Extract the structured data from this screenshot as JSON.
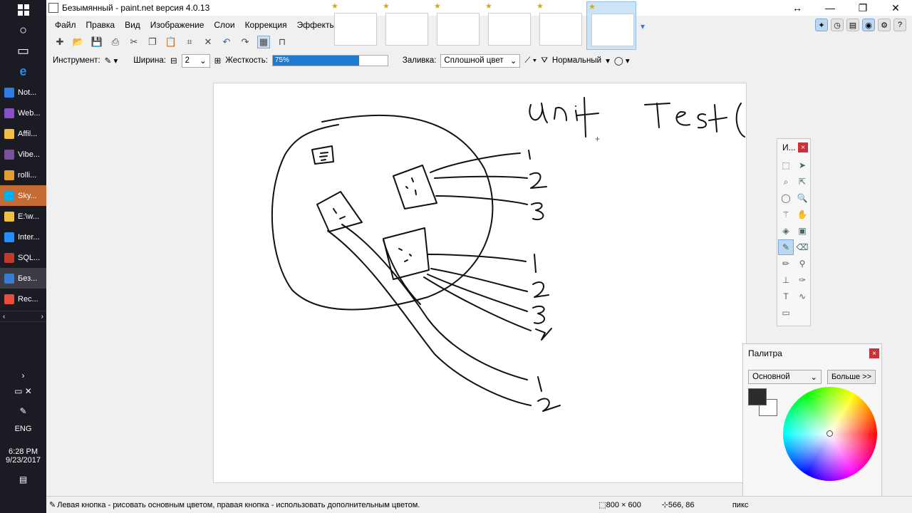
{
  "window": {
    "title": "Безымянный - paint.net версия 4.0.13"
  },
  "menu": {
    "items": [
      "Файл",
      "Правка",
      "Вид",
      "Изображение",
      "Слои",
      "Коррекция",
      "Эффекты"
    ]
  },
  "toolbar": {
    "tool_label": "Инструмент:",
    "width_label": "Ширина:",
    "width_value": "2",
    "hardness_label": "Жесткость:",
    "hardness_value": "75%",
    "hardness_fraction": 0.75,
    "fill_label": "Заливка:",
    "fill_value": "Сплошной цвет",
    "blend_value": "Нормальный"
  },
  "tools_panel": {
    "title": "И...",
    "close": "×"
  },
  "palette": {
    "title": "Палитра",
    "close": "×",
    "mode": "Основной",
    "more": "Больше >>",
    "primary_color": "#2c2c2c",
    "secondary_color": "#ffffff"
  },
  "status": {
    "hint": "Левая кнопка - рисовать основным цветом, правая кнопка - использовать дополнительным цветом.",
    "image_size": "800 × 600",
    "cursor_pos": "566, 86",
    "unit": "пикс"
  },
  "taskbar": {
    "apps": [
      {
        "label": "Not...",
        "color": "#2f7de1"
      },
      {
        "label": "Web...",
        "color": "#8a4fc6"
      },
      {
        "label": "Affil...",
        "color": "#f0c040"
      },
      {
        "label": "Vibe...",
        "color": "#7b519d"
      },
      {
        "label": "rolli...",
        "color": "#e0a030"
      },
      {
        "label": "Sky...",
        "color": "#00aff0"
      },
      {
        "label": "E:\\w...",
        "color": "#f0c040"
      },
      {
        "label": "Inter...",
        "color": "#1e90ff"
      },
      {
        "label": "SQL...",
        "color": "#c0392b"
      },
      {
        "label": "Без...",
        "color": "#3a7bd5"
      },
      {
        "label": "Rec...",
        "color": "#e74c3c"
      }
    ],
    "language": "ENG",
    "time": "6:28 PM",
    "date": "9/23/2017"
  },
  "canvas_text": {
    "heading": "Unit Tests"
  }
}
